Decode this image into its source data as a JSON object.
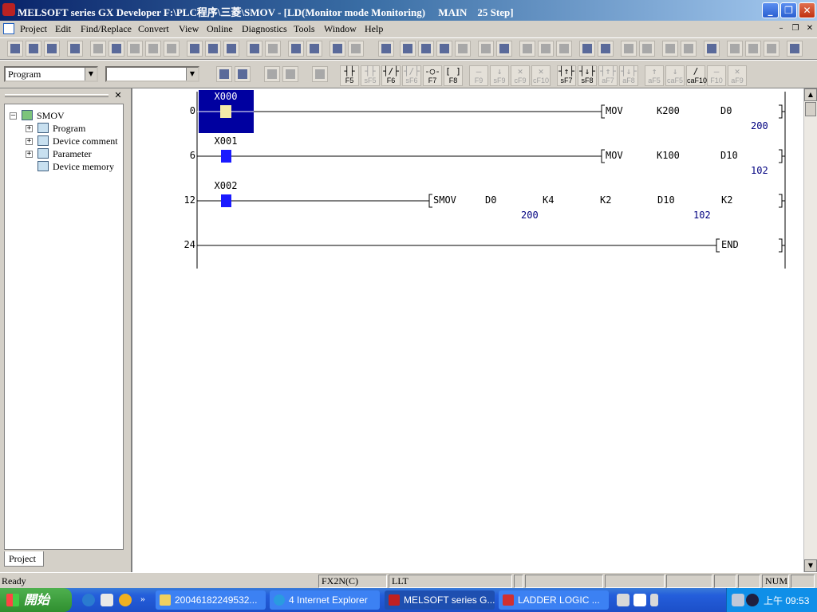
{
  "window": {
    "title": "MELSOFT series GX Developer F:\\PLC程序\\三菱\\SMOV - [LD(Monitor mode Monitoring)     MAIN    25 Step]",
    "minimize_glyph": "_",
    "maximize_glyph": "❐",
    "close_glyph": "✕"
  },
  "menubar": {
    "items": [
      "Project",
      "Edit",
      "Find/Replace",
      "Convert",
      "View",
      "Online",
      "Diagnostics",
      "Tools",
      "Window",
      "Help"
    ],
    "mdi_min": "–",
    "mdi_restore": "❐",
    "mdi_close": "✕"
  },
  "toolbar2": {
    "data_type_combo": "Program",
    "second_combo": "",
    "function_keys": [
      {
        "sym": "┤├",
        "label": "F5"
      },
      {
        "sym": "┤├",
        "label": "sF5"
      },
      {
        "sym": "┤/├",
        "label": "F6"
      },
      {
        "sym": "┤/├",
        "label": "sF6"
      },
      {
        "sym": "-○-",
        "label": "F7"
      },
      {
        "sym": "[ ]",
        "label": "F8"
      },
      {
        "sym": "—",
        "label": "F9"
      },
      {
        "sym": "↓",
        "label": "sF9"
      },
      {
        "sym": "✕",
        "label": "cF9"
      },
      {
        "sym": "✕",
        "label": "cF10"
      },
      {
        "sym": "┤↑├",
        "label": "sF7"
      },
      {
        "sym": "┤↓├",
        "label": "sF8"
      },
      {
        "sym": "┤↑├",
        "label": "aF7"
      },
      {
        "sym": "┤↓├",
        "label": "aF8"
      },
      {
        "sym": "↑",
        "label": "aF5"
      },
      {
        "sym": "↓",
        "label": "caF5"
      },
      {
        "sym": "/",
        "label": "caF10"
      },
      {
        "sym": "—",
        "label": "F10"
      },
      {
        "sym": "✕",
        "label": "aF9"
      }
    ]
  },
  "project_panel": {
    "close_glyph": "✕",
    "tree": [
      {
        "label": "SMOV",
        "expander": "–",
        "level": 0
      },
      {
        "label": "Program",
        "expander": "+",
        "level": 1
      },
      {
        "label": "Device comment",
        "expander": "+",
        "level": 1
      },
      {
        "label": "Parameter",
        "expander": "+",
        "level": 1
      },
      {
        "label": "Device memory",
        "expander": "",
        "level": 1
      }
    ],
    "tab_label": "Project"
  },
  "ladder": {
    "rungs": [
      {
        "step": "0",
        "contact": "X000",
        "selected": true,
        "instruction": [
          "MOV",
          "K200",
          "D0"
        ],
        "monitor_values": [
          "200"
        ]
      },
      {
        "step": "6",
        "contact": "X001",
        "selected": false,
        "instruction": [
          "MOV",
          "K100",
          "D10"
        ],
        "monitor_values": [
          "102"
        ]
      },
      {
        "step": "12",
        "contact": "X002",
        "selected": false,
        "instruction": [
          "SMOV",
          "D0",
          "K4",
          "K2",
          "D10",
          "K2"
        ],
        "monitor_values": [
          "200",
          "102"
        ]
      },
      {
        "step": "24",
        "contact": "",
        "selected": false,
        "instruction": [
          "END"
        ],
        "monitor_values": []
      }
    ],
    "colors": {
      "contact_on": "#1a1aff",
      "selection": "#0000a0",
      "monitor_value": "#000080"
    }
  },
  "scrollbar": {
    "up": "▲",
    "down": "▼"
  },
  "statusbar": {
    "status": "Ready",
    "plc_type": "FX2N(C)",
    "connection": "LLT",
    "num": "NUM"
  },
  "taskbar": {
    "start_label": "開始",
    "quick_launch_more": "»",
    "items": [
      {
        "label": "20046182249532...",
        "active": false
      },
      {
        "label": "4 Internet Explorer",
        "active": false
      },
      {
        "label": "MELSOFT series G...",
        "active": true
      },
      {
        "label": "LADDER LOGIC ...",
        "active": false
      }
    ],
    "clock": "上午 09:53"
  }
}
